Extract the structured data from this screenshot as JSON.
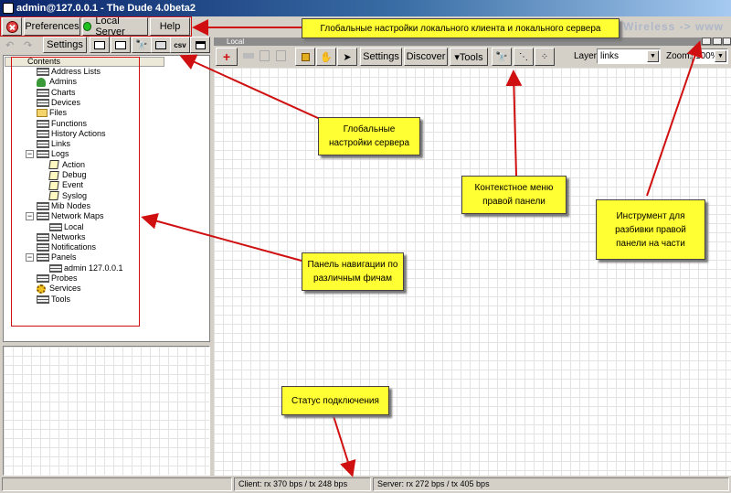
{
  "window": {
    "title": "admin@127.0.0.1 - The Dude 4.0beta2",
    "brand_text": "ᴅ Wireless -> www"
  },
  "main_toolbar": {
    "preferences_label": "Preferences",
    "local_server_label": "Local Server",
    "help_label": "Help"
  },
  "left_toolbar": {
    "settings_label": "Settings",
    "csv_label": "csv"
  },
  "tree": {
    "header": "Contents",
    "items": [
      {
        "label": "Address Lists",
        "icon": "table-icon"
      },
      {
        "label": "Admins",
        "icon": "admin-icon"
      },
      {
        "label": "Charts",
        "icon": "table-icon"
      },
      {
        "label": "Devices",
        "icon": "table-icon"
      },
      {
        "label": "Files",
        "icon": "folder-icon"
      },
      {
        "label": "Functions",
        "icon": "table-icon"
      },
      {
        "label": "History Actions",
        "icon": "table-icon"
      },
      {
        "label": "Links",
        "icon": "table-icon"
      },
      {
        "label": "Logs",
        "icon": "table-icon"
      },
      {
        "label": "Action",
        "icon": "note-icon"
      },
      {
        "label": "Debug",
        "icon": "note-icon"
      },
      {
        "label": "Event",
        "icon": "note-icon"
      },
      {
        "label": "Syslog",
        "icon": "note-icon"
      },
      {
        "label": "Mib Nodes",
        "icon": "table-icon"
      },
      {
        "label": "Network Maps",
        "icon": "table-icon"
      },
      {
        "label": "Local",
        "icon": "table-icon"
      },
      {
        "label": "Networks",
        "icon": "table-icon"
      },
      {
        "label": "Notifications",
        "icon": "table-icon"
      },
      {
        "label": "Panels",
        "icon": "table-icon"
      },
      {
        "label": "admin 127.0.0.1",
        "icon": "table-icon"
      },
      {
        "label": "Probes",
        "icon": "table-icon"
      },
      {
        "label": "Services",
        "icon": "gear-icon"
      },
      {
        "label": "Tools",
        "icon": "table-icon"
      }
    ]
  },
  "right_panel": {
    "header": "Local",
    "settings_label": "Settings",
    "discover_label": "Discover",
    "tools_label": "▾Tools",
    "layer_label": "Layer:",
    "layer_value": "links",
    "zoom_label": "Zoom:",
    "zoom_value": "100%"
  },
  "status": {
    "client": "Client: rx 370 bps / tx 248 bps",
    "server": "Server: rx 272 bps / tx 405 bps"
  },
  "annotations": {
    "global_client_settings": "Глобальные настройки локального клиента и локального сервера",
    "global_server_settings": "Глобальные настройки сервера",
    "context_menu": "Контекстное меню правой панели",
    "split_tool": "Инструмент для разбивки правой панели на части",
    "navigation_panel": "Панель навигации по различным фичам",
    "connection_status": "Статус подключения"
  },
  "colors": {
    "annotation_fill": "#ffff33",
    "annotation_stroke": "#d01010",
    "title_bar": "#0a246a"
  }
}
